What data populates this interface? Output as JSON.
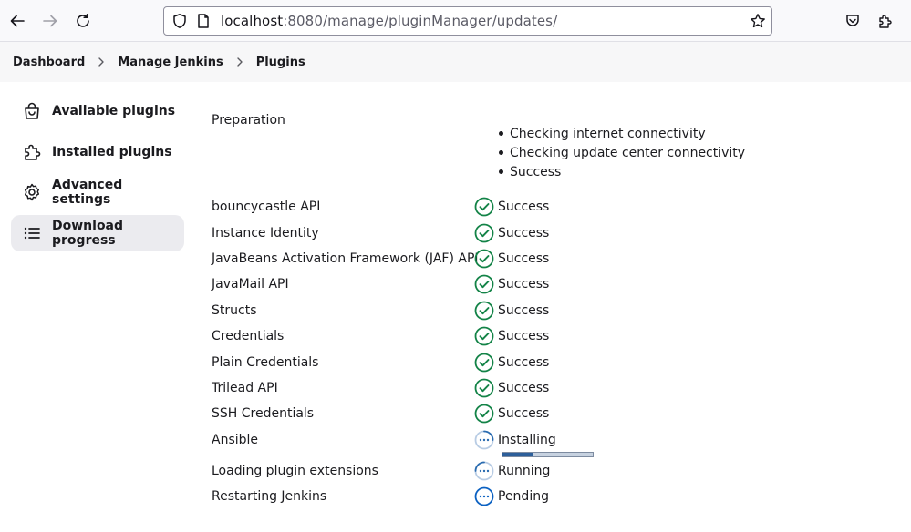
{
  "browser": {
    "url_host": "localhost",
    "url_path": ":8080/manage/pluginManager/updates/"
  },
  "breadcrumb": [
    "Dashboard",
    "Manage Jenkins",
    "Plugins"
  ],
  "sidebar": {
    "items": [
      {
        "label": "Available plugins",
        "icon": "shopping-bag-icon",
        "active": false
      },
      {
        "label": "Installed plugins",
        "icon": "puzzle-icon",
        "active": false
      },
      {
        "label": "Advanced settings",
        "icon": "gear-icon",
        "active": false
      },
      {
        "label": "Download progress",
        "icon": "list-icon",
        "active": true
      }
    ]
  },
  "preparation": {
    "label": "Preparation",
    "steps": [
      "Checking internet connectivity",
      "Checking update center connectivity",
      "Success"
    ]
  },
  "jobs": [
    {
      "name": "bouncycastle API",
      "status": "Success"
    },
    {
      "name": "Instance Identity",
      "status": "Success"
    },
    {
      "name": "JavaBeans Activation Framework (JAF) API",
      "status": "Success"
    },
    {
      "name": "JavaMail API",
      "status": "Success"
    },
    {
      "name": "Structs",
      "status": "Success"
    },
    {
      "name": "Credentials",
      "status": "Success"
    },
    {
      "name": "Plain Credentials",
      "status": "Success"
    },
    {
      "name": "Trilead API",
      "status": "Success"
    },
    {
      "name": "SSH Credentials",
      "status": "Success"
    },
    {
      "name": "Ansible",
      "status": "Installing",
      "progress": 0.33
    },
    {
      "name": "Loading plugin extensions",
      "status": "Running"
    },
    {
      "name": "Restarting Jenkins",
      "status": "Pending"
    }
  ],
  "colors": {
    "success": "#138347",
    "in_progress": "#2b6cb0",
    "pending": "#0b61c2"
  }
}
